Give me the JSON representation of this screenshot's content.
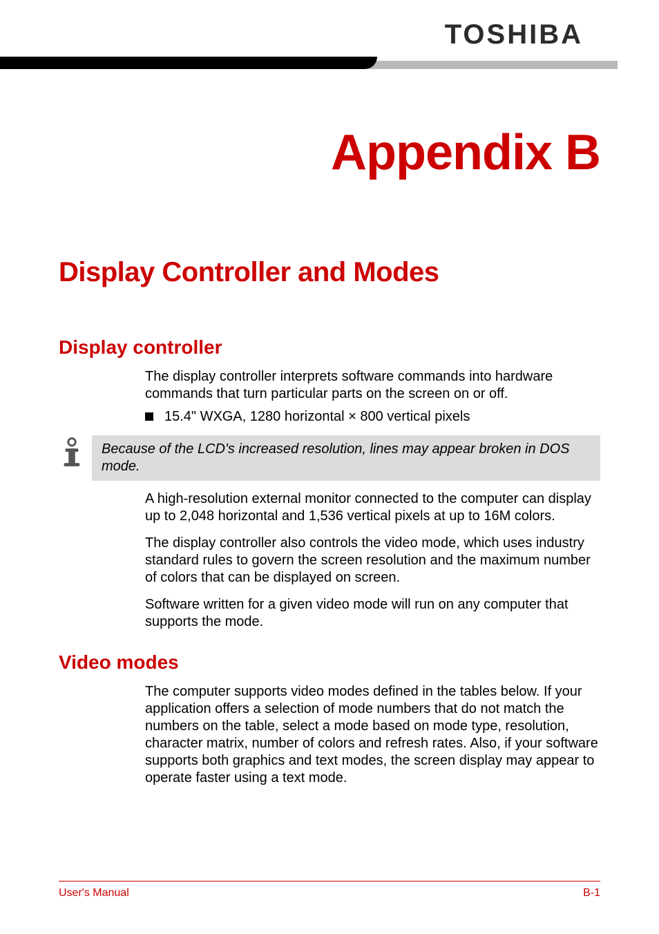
{
  "brand": "TOSHIBA",
  "appendix_title": "Appendix B",
  "section_title": "Display Controller and Modes",
  "display_controller": {
    "heading": "Display controller",
    "p1": "The display controller interprets software commands into hardware commands that turn particular parts on the screen on or off.",
    "bullet": "15.4\" WXGA, 1280 horizontal × 800 vertical pixels",
    "note": "Because of the LCD's increased resolution, lines may appear broken in DOS mode.",
    "p2": "A high-resolution external monitor connected to the computer can display up to 2,048 horizontal and 1,536 vertical pixels at up to 16M colors.",
    "p3": "The display controller also controls the video mode, which uses industry standard rules to govern the screen resolution and the maximum number of colors that can be displayed on screen.",
    "p4": "Software written for a given video mode will run on any computer that supports the mode."
  },
  "video_modes": {
    "heading": "Video modes",
    "p1": "The computer supports video modes defined in the tables below. If your application offers a selection of mode numbers that do not match the numbers on the table, select a mode based on mode type, resolution, character matrix, number of colors and refresh rates. Also, if your software supports both graphics and text modes, the screen display may appear to operate faster using a text mode."
  },
  "footer": {
    "left": "User's Manual",
    "right": "B-1"
  }
}
